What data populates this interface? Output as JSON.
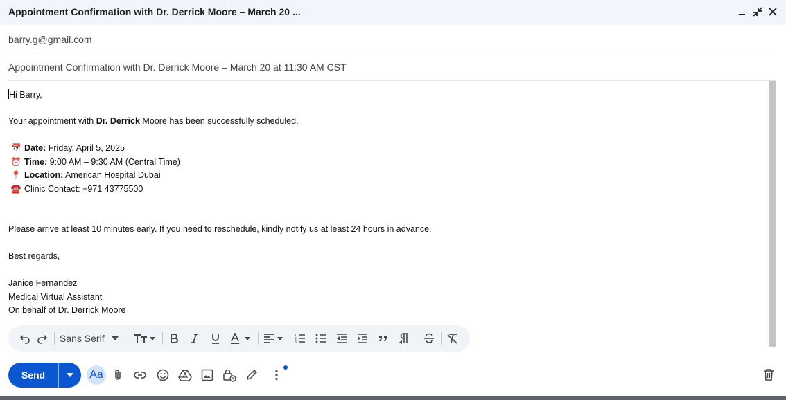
{
  "window": {
    "title": "Appointment Confirmation with Dr. Derrick Moore – March 20 ..."
  },
  "compose": {
    "to": "barry.g@gmail.com",
    "subject": "Appointment Confirmation with Dr. Derrick Moore – March 20 at 11:30 AM CST"
  },
  "email_body": {
    "greeting": "Hi Barry,",
    "intro_pre": "Your appointment with ",
    "intro_bold": "Dr. Derrick",
    "intro_post": " Moore has been successfully scheduled.",
    "details": [
      {
        "emoji": "📅",
        "label": "Date:",
        "value": " Friday, April 5, 2025"
      },
      {
        "emoji": "⏰",
        "label": "Time:",
        "value": " 9:00 AM – 9:30 AM (Central Time)"
      },
      {
        "emoji": "📍",
        "label": "Location:",
        "value": " American Hospital Dubai"
      },
      {
        "emoji": "☎️",
        "label": "",
        "value": "Clinic Contact: +971 43775500"
      }
    ],
    "note": "Please arrive at least 10 minutes early. If you need to reschedule, kindly notify us at least 24 hours in advance.",
    "closing": "Best regards,",
    "signature": [
      "Janice Fernandez",
      "Medical Virtual Assistant",
      "On behalf of Dr. Derrick Moore"
    ]
  },
  "formatting_toolbar": {
    "font": "Sans Serif",
    "tools": [
      "undo-icon",
      "redo-icon",
      "font-size-icon",
      "bold-icon",
      "italic-icon",
      "underline-icon",
      "text-color-icon",
      "align-icon",
      "numbered-list-icon",
      "bulleted-list-icon",
      "indent-less-icon",
      "indent-more-icon",
      "quote-icon",
      "rtl-icon",
      "strikethrough-icon",
      "remove-formatting-icon"
    ]
  },
  "bottom_bar": {
    "send_label": "Send",
    "format_label": "Aa",
    "tools": [
      "attach-icon",
      "link-icon",
      "emoji-icon",
      "drive-icon",
      "photo-icon",
      "confidential-icon",
      "signature-icon",
      "more-options-icon",
      "trash-icon"
    ]
  },
  "colors": {
    "accent": "#0b57d0",
    "titlebar_bg": "#f2f6fc",
    "toolbar_bg": "#f0f4f9"
  }
}
